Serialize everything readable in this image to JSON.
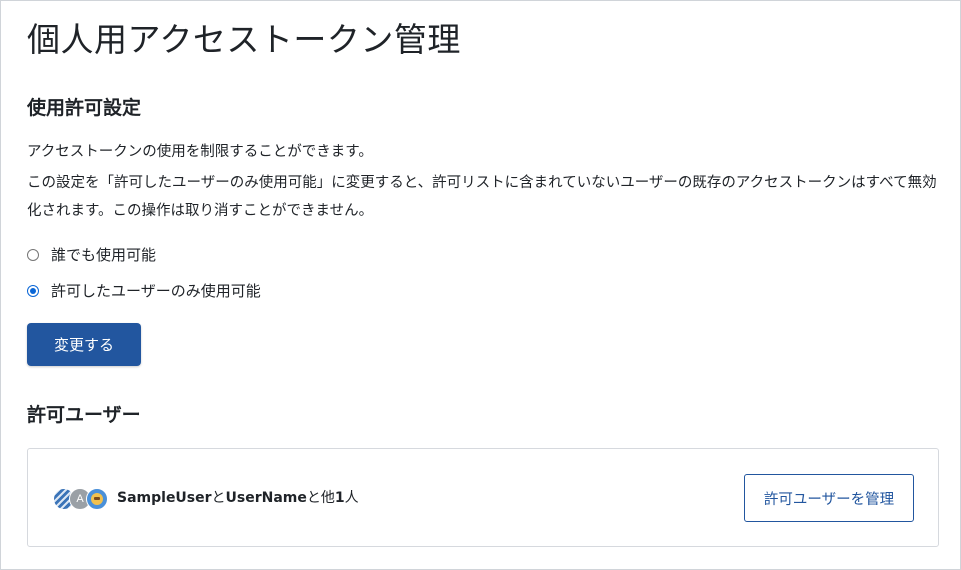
{
  "page": {
    "title": "個人用アクセストークン管理"
  },
  "usage": {
    "heading": "使用許可設定",
    "description1": "アクセストークンの使用を制限することができます。",
    "description2": "この設定を「許可したユーザーのみ使用可能」に変更すると、許可リストに含まれていないユーザーの既存のアクセストークンはすべて無効化されます。この操作は取り消すことができません。",
    "options": [
      {
        "label": "誰でも使用可能",
        "selected": false
      },
      {
        "label": "許可したユーザーのみ使用可能",
        "selected": true
      }
    ],
    "submit_label": "変更する"
  },
  "allowed_users": {
    "heading": "許可ユーザー",
    "avatar_letter": "A",
    "user1": "SampleUser",
    "conj1": "と",
    "user2": "UserName",
    "conj2": "と他",
    "count": "1",
    "count_suffix": "人",
    "manage_label": "許可ユーザーを管理"
  }
}
